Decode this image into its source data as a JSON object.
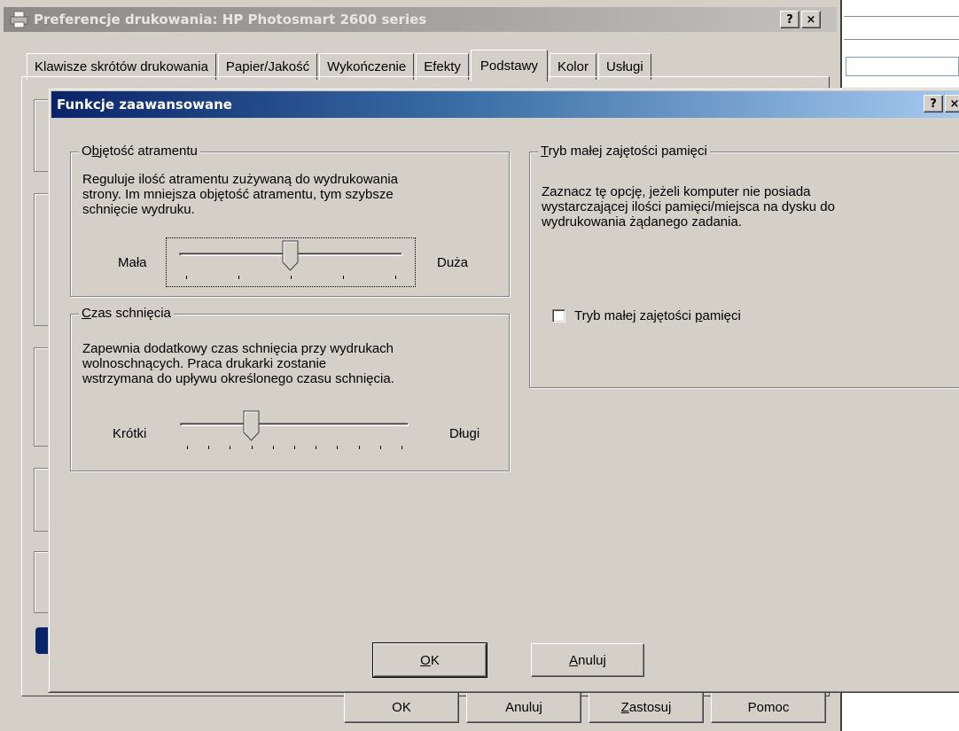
{
  "parent_window": {
    "title": "Preferencje drukowania: HP Photosmart 2600 series",
    "help_btn": "?",
    "close_btn": "×",
    "tabs": [
      {
        "label": "Klawisze skrótów drukowania"
      },
      {
        "label": "Papier/Jakość"
      },
      {
        "label": "Wykończenie"
      },
      {
        "label": "Efekty"
      },
      {
        "label": "Podstawy",
        "active": true
      },
      {
        "label": "Kolor"
      },
      {
        "label": "Usługi"
      }
    ],
    "buttons": {
      "ok": "OK",
      "cancel": "Anuluj",
      "apply": "Zastosuj",
      "help": "Pomoc"
    }
  },
  "dialog": {
    "title": "Funkcje zaawansowane",
    "help_btn": "?",
    "close_btn": "×",
    "ink_volume": {
      "legend": "Objętość atramentu",
      "description": [
        "Reguluje ilość atramentu zużywaną do wydrukowania",
        "strony. Im mniejsza objętość atramentu, tym szybsze",
        "schnięcie wydruku."
      ],
      "min_label": "Mała",
      "max_label": "Duża",
      "tick_count": 5,
      "position": 2
    },
    "drying_time": {
      "legend": "Czas schnięcia",
      "description": [
        "Zapewnia dodatkowy czas schnięcia przy wydrukach",
        "wolnoschnących. Praca drukarki zostanie",
        "wstrzymana do upływu określonego czasu schnięcia."
      ],
      "min_label": "Krótki",
      "max_label": "Długi",
      "tick_count": 11,
      "position": 3
    },
    "low_memory": {
      "legend": "Tryb małej zajętości pamięci",
      "description": [
        "Zaznacz tę opcję, jeżeli komputer nie posiada",
        "wystarczającej ilości pamięci/miejsca na dysku do",
        "wydrukowania żądanego zadania."
      ],
      "checkbox_label": "Tryb małej zajętości pamięci",
      "checked": false
    },
    "buttons": {
      "ok": "OK",
      "cancel": "Anuluj"
    }
  }
}
